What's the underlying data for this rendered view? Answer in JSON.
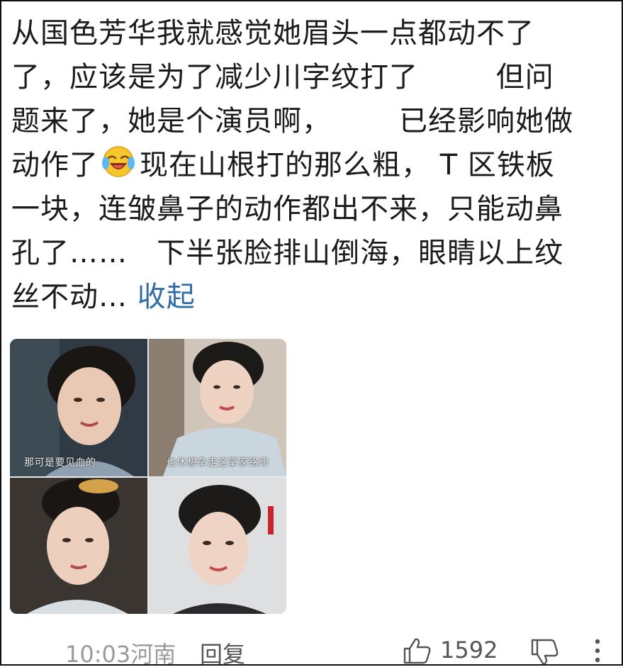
{
  "comment": {
    "lines": [
      "从国色芳华我就感觉她眉头一点都动不了",
      "了，应该是为了减少川字纹打了        但问",
      "题来了，她是个演员啊，       已经影响她做",
      "现在山根打的那么粗， T 区铁板",
      "一块，连皱鼻子的动作都出不来，只能动鼻",
      "孔了……   下半张脸排山倒海，眼睛以上纹",
      "丝不动…"
    ],
    "line4_prefix": "动作了",
    "emoji_icon": "laughing-crying-emoji-icon",
    "collapse_label": "收起"
  },
  "images": {
    "subtitles": [
      "那可是要见血的",
      "也休想拿走这掌家铭印",
      "",
      ""
    ]
  },
  "footer": {
    "time": "10:03",
    "location": "河南",
    "reply_label": "回复",
    "like_count": "1592",
    "like_icon": "thumbs-up-icon",
    "dislike_icon": "thumbs-down-icon",
    "more_icon": "more-vertical-icon"
  },
  "colors": {
    "text": "#1b1b1b",
    "link": "#2e6da8",
    "meta": "#9a9a9a"
  }
}
